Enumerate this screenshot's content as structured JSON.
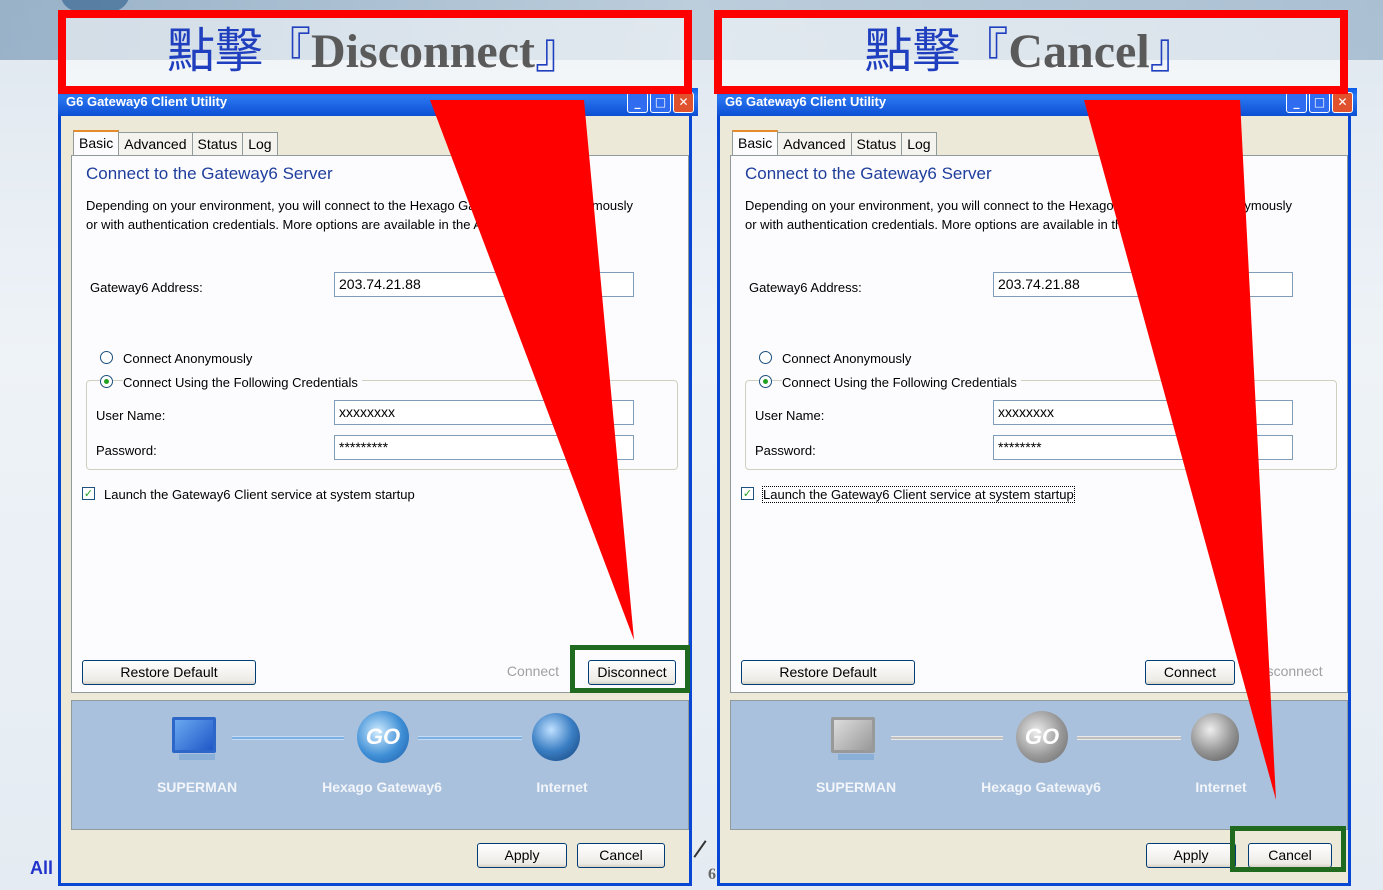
{
  "callouts": {
    "left": {
      "text_cjk": "點擊『",
      "text_en": "Disconnect",
      "text_end": "』"
    },
    "right": {
      "text_cjk": "點擊『",
      "text_en": "Cancel",
      "text_end": "』"
    }
  },
  "windows": [
    {
      "title": "G6 Gateway6 Client Utility",
      "tabs": [
        "Basic",
        "Advanced",
        "Status",
        "Log"
      ],
      "heading": "Connect to the Gateway6 Server",
      "description": "Depending on your environment, you will connect to the Hexago Gateway6 either anonymously or with authentication credentials. More options are available in the Advanced tab.",
      "address_label": "Gateway6 Address:",
      "address_value": "203.74.21.88",
      "radio_anonymous": "Connect Anonymously",
      "radio_credentials": "Connect Using the Following Credentials",
      "username_label": "User Name:",
      "username_value": "xxxxxxxx",
      "password_label": "Password:",
      "password_value": "*********",
      "startup_label": "Launch the Gateway6 Client service at system startup",
      "restore_label": "Restore Default",
      "connect_label": "Connect",
      "disconnect_label": "Disconnect",
      "graphic_labels": [
        "SUPERMAN",
        "Hexago Gateway6",
        "Internet"
      ],
      "apply_label": "Apply",
      "cancel_label": "Cancel"
    },
    {
      "title": "G6 Gateway6 Client Utility",
      "tabs": [
        "Basic",
        "Advanced",
        "Status",
        "Log"
      ],
      "heading": "Connect to the Gateway6 Server",
      "description": "Depending on your environment, you will connect to the Hexago Gateway6 either anonymously or with authentication credentials. More options are available in the Advanced tab.",
      "address_label": "Gateway6 Address:",
      "address_value": "203.74.21.88",
      "radio_anonymous": "Connect Anonymously",
      "radio_credentials": "Connect Using the Following Credentials",
      "username_label": "User Name:",
      "username_value": "xxxxxxxx",
      "password_label": "Password:",
      "password_value": "********",
      "startup_label": "Launch the Gateway6 Client service at system startup",
      "restore_label": "Restore Default",
      "connect_label": "Connect",
      "disconnect_label": "Disconnect",
      "graphic_labels": [
        "SUPERMAN",
        "Hexago Gateway6",
        "Internet"
      ],
      "apply_label": "Apply",
      "cancel_label": "Cancel"
    }
  ],
  "footer": {
    "left_text": "All",
    "page": "6"
  },
  "colors": {
    "callout_border": "#ff0000",
    "highlight_border": "#1f6a1f",
    "titlebar": "#0a5be8"
  }
}
